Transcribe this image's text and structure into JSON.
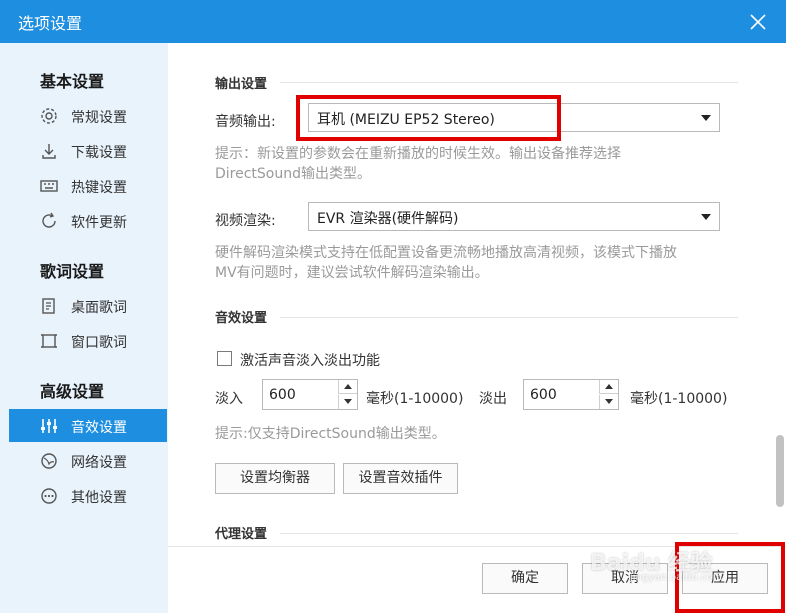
{
  "window": {
    "title": "选项设置"
  },
  "sidebar": {
    "groups": [
      {
        "title": "基本设置",
        "items": [
          {
            "label": "常规设置",
            "icon": "settings-icon"
          },
          {
            "label": "下载设置",
            "icon": "download-icon"
          },
          {
            "label": "热键设置",
            "icon": "keyboard-icon"
          },
          {
            "label": "软件更新",
            "icon": "update-icon"
          }
        ]
      },
      {
        "title": "歌词设置",
        "items": [
          {
            "label": "桌面歌词",
            "icon": "desktop-lyrics-icon"
          },
          {
            "label": "窗口歌词",
            "icon": "window-lyrics-icon"
          }
        ]
      },
      {
        "title": "高级设置",
        "items": [
          {
            "label": "音效设置",
            "icon": "equalizer-icon",
            "active": true
          },
          {
            "label": "网络设置",
            "icon": "network-icon"
          },
          {
            "label": "其他设置",
            "icon": "more-icon"
          }
        ]
      }
    ]
  },
  "output": {
    "section_title": "输出设置",
    "audio_label": "音频输出:",
    "audio_value": "耳机 (MEIZU EP52 Stereo)",
    "audio_hint_1": "提示：新设置的参数会在重新播放的时候生效。输出设备推荐选择",
    "audio_hint_2": "DirectSound输出类型。",
    "video_label": "视频渲染:",
    "video_value": "EVR 渲染器(硬件解码)",
    "video_hint_1": "硬件解码渲染模式支持在低配置设备更流畅地播放高清视频，该模式下播放",
    "video_hint_2": "MV有问题时，建议尝试软件解码渲染输出。"
  },
  "effects": {
    "section_title": "音效设置",
    "fade_checkbox_label": "激活声音淡入淡出功能",
    "fade_in_label": "淡入",
    "fade_in_value": "600",
    "fade_in_unit": "毫秒(1-10000)",
    "fade_out_label": "淡出",
    "fade_out_value": "600",
    "fade_out_unit": "毫秒(1-10000)",
    "hint": "提示:仅支持DirectSound输出类型。",
    "eq_button": "设置均衡器",
    "plugin_button": "设置音效插件"
  },
  "proxy": {
    "section_title": "代理设置"
  },
  "footer": {
    "ok": "确定",
    "cancel": "取消",
    "apply": "应用"
  },
  "watermark": {
    "brand": "Baidu 经验",
    "url": "jingyan.baidu.com"
  },
  "colors": {
    "accent": "#1e8fe0",
    "highlight": "#e00000",
    "sidebar_bg": "#e8f3fc"
  }
}
